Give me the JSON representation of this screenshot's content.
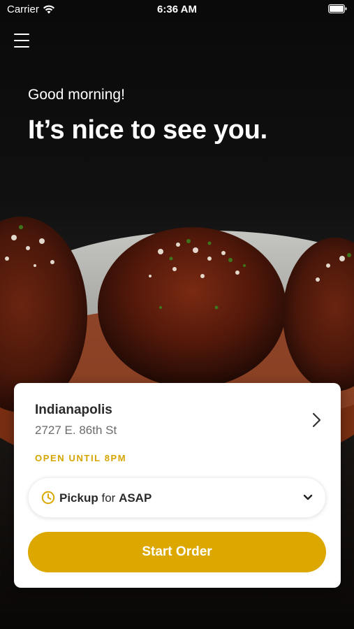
{
  "status_bar": {
    "carrier": "Carrier",
    "time": "6:36 AM",
    "icons": [
      "wifi-icon",
      "battery-icon"
    ]
  },
  "header": {
    "menu_icon": "hamburger-menu-icon",
    "greeting": "Good morning!",
    "headline": "It’s nice to see you."
  },
  "location_card": {
    "name": "Indianapolis",
    "address": "2727 E. 86th St",
    "hours_status": "OPEN UNTIL 8PM",
    "chevron_icon": "chevron-right-icon",
    "order_type": {
      "method": "Pickup",
      "connector": "for",
      "time": "ASAP",
      "icon": "clock-icon",
      "dropdown_icon": "chevron-down-icon"
    },
    "start_button_label": "Start Order"
  },
  "colors": {
    "accent": "#dca800",
    "hours_text": "#d6a500",
    "background": "#0b0b0b",
    "card": "#ffffff"
  }
}
